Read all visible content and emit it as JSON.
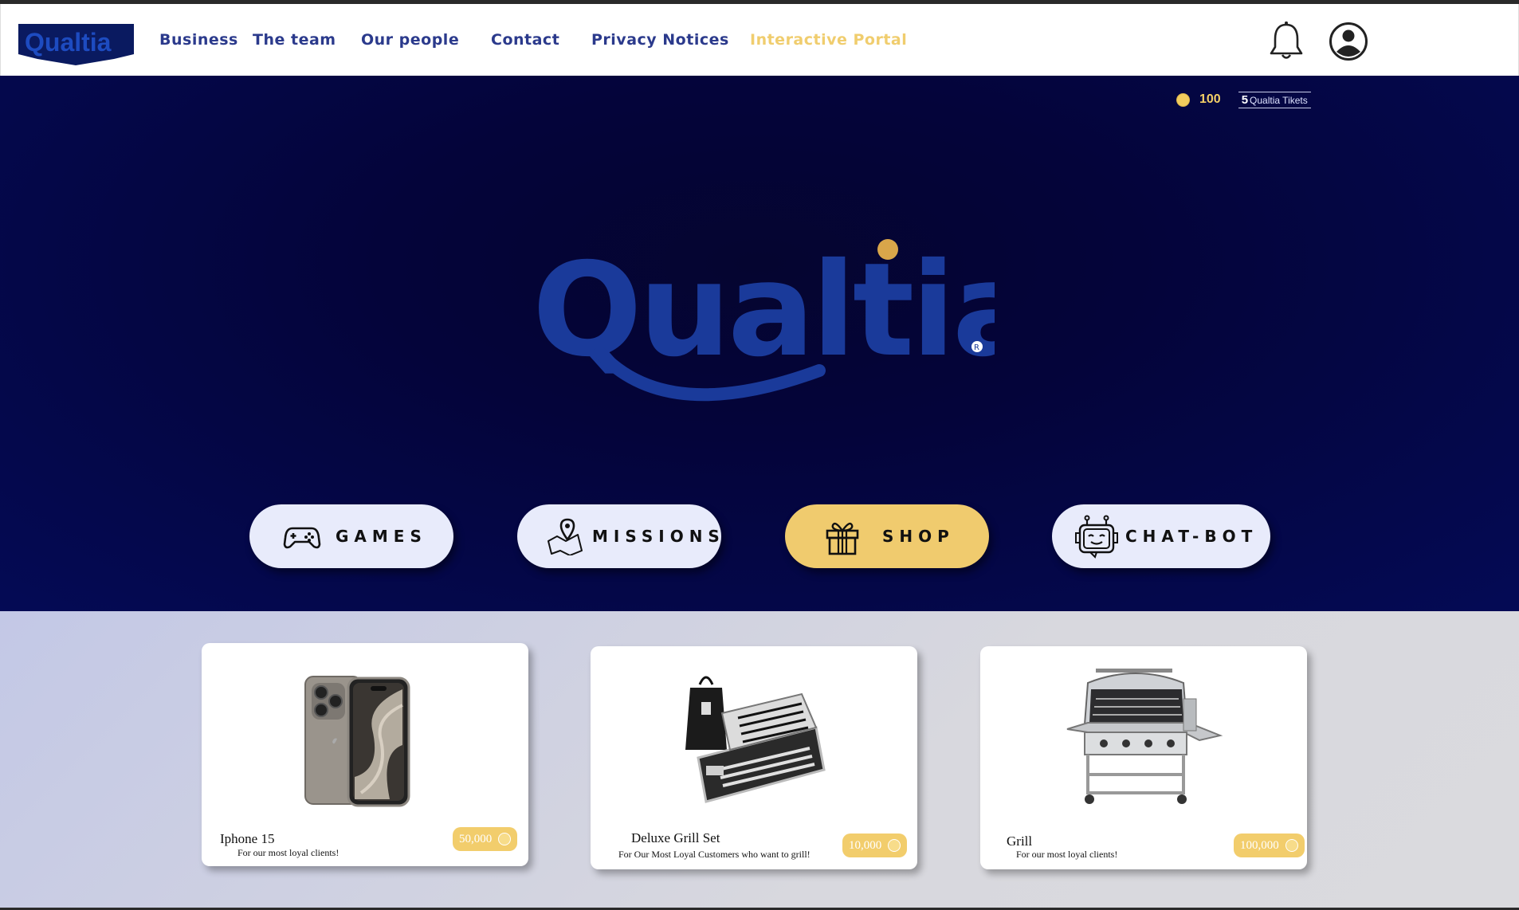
{
  "header": {
    "logo_text": "Qualtia",
    "nav": [
      {
        "label": "Business",
        "active": false
      },
      {
        "label": "The team",
        "active": false
      },
      {
        "label": "Our people",
        "active": false
      },
      {
        "label": "Contact",
        "active": false
      },
      {
        "label": "Privacy Notices",
        "active": false
      },
      {
        "label": "Interactive Portal",
        "active": true
      }
    ],
    "icons": [
      "bell-icon",
      "user-icon"
    ]
  },
  "hero": {
    "coins": "100",
    "tickets_count": "5",
    "tickets_label": "Qualtia Tikets",
    "logo_text": "Qualtia",
    "buttons": [
      {
        "label": "GAMES",
        "icon": "gamepad-icon"
      },
      {
        "label": "MISSIONS",
        "icon": "map-pin-icon"
      },
      {
        "label": "SHOP",
        "icon": "gift-icon",
        "active": true
      },
      {
        "label": "CHAT-BOT",
        "icon": "robot-icon"
      }
    ]
  },
  "products": [
    {
      "name": "Iphone 15",
      "description": "For our most loyal clients!",
      "price": "50,000"
    },
    {
      "name": "Deluxe Grill Set",
      "description": "For Our Most Loyal Customers who want to grill!",
      "price": "10,000"
    },
    {
      "name": "Grill",
      "description": "For our most loyal clients!",
      "price": "100,000"
    }
  ],
  "colors": {
    "brand_blue": "#1a3a9a",
    "nav_text": "#2b3a8c",
    "accent_gold": "#f0cb6e",
    "hero_bg": "#040a55"
  }
}
